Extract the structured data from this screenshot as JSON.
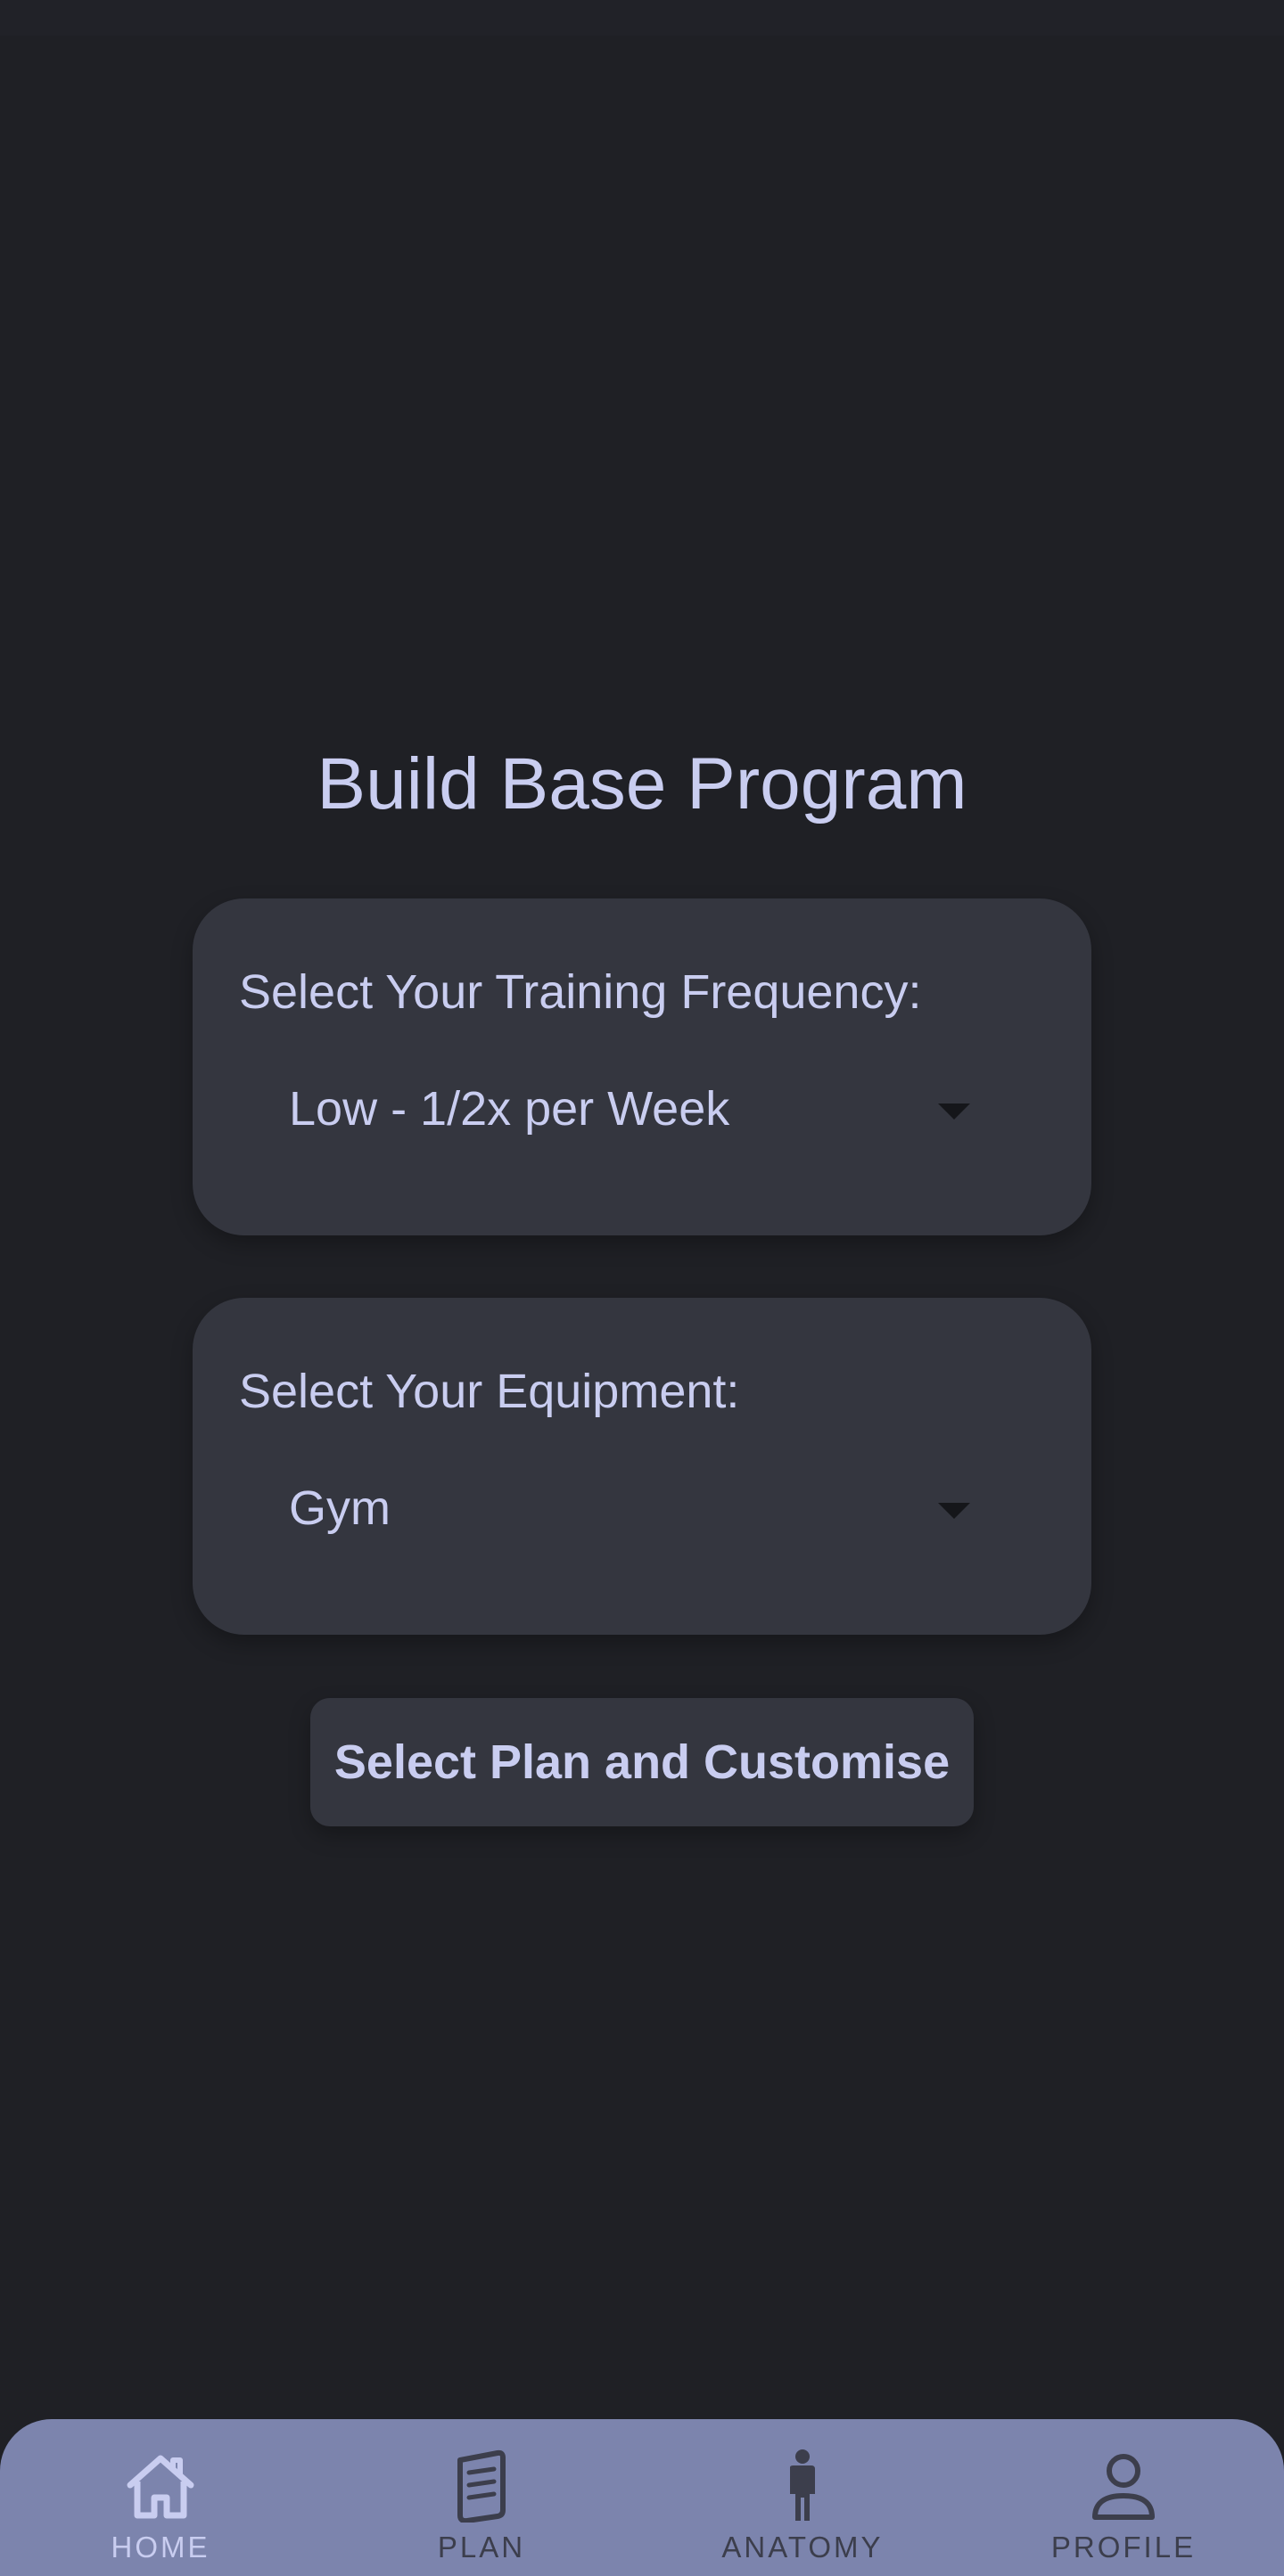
{
  "page": {
    "title": "Build Base Program"
  },
  "frequency": {
    "label": "Select Your Training Frequency:",
    "selected": "Low - 1/2x per Week"
  },
  "equipment": {
    "label": "Select Your Equipment:",
    "selected": "Gym"
  },
  "action": {
    "button_label": "Select Plan and Customise"
  },
  "nav": {
    "items": [
      {
        "label": "HOME",
        "icon": "home-icon",
        "active": true
      },
      {
        "label": "PLAN",
        "icon": "document-icon",
        "active": false
      },
      {
        "label": "ANATOMY",
        "icon": "person-icon",
        "active": false
      },
      {
        "label": "PROFILE",
        "icon": "profile-icon",
        "active": false
      }
    ]
  },
  "colors": {
    "background": "#1f2025",
    "card": "#34363f",
    "text": "#c9cdf0",
    "nav_bar": "#7c84ad",
    "nav_active": "#c9cdf0",
    "nav_inactive": "#3c3e4c"
  }
}
